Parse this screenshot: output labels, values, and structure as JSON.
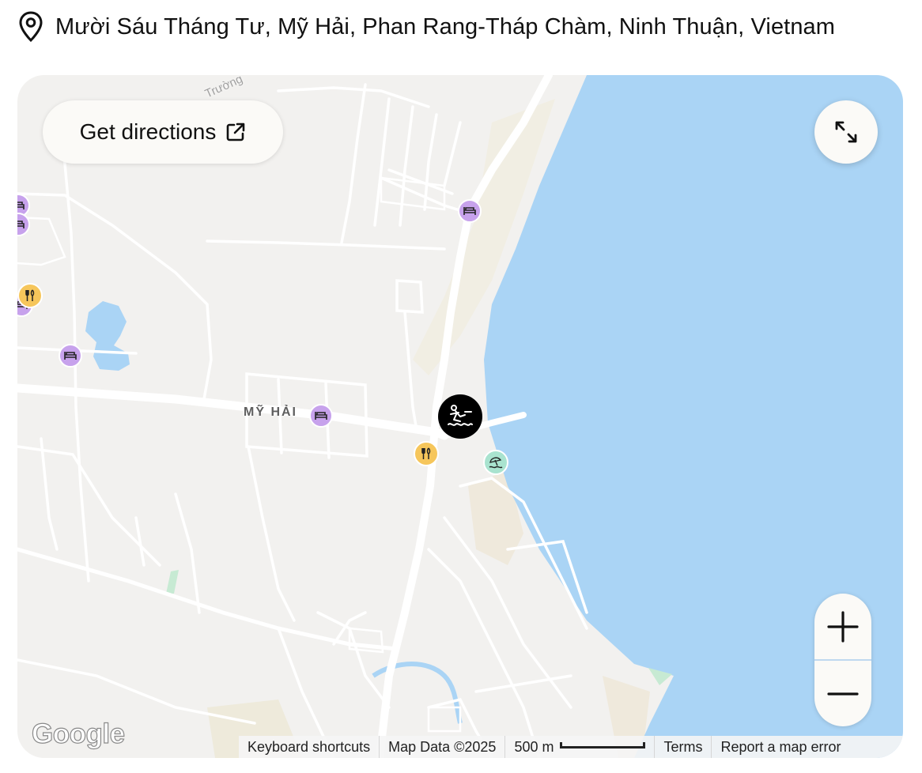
{
  "header": {
    "address": "Mười Sáu Tháng Tư, Mỹ Hải, Phan Rang-Tháp Chàm, Ninh Thuận, Vietnam",
    "icon": "map-pin-icon"
  },
  "map": {
    "directions_label": "Get directions",
    "directions_icon": "external-link-icon",
    "fullscreen_icon": "expand-icon",
    "zoom_in_icon": "plus-icon",
    "zoom_out_icon": "minus-icon",
    "area_label": "MỸ HẢI",
    "street_label": "Trường",
    "logo_text": "Google",
    "attribution": {
      "shortcuts": "Keyboard shortcuts",
      "map_data": "Map Data ©2025",
      "scale": "500 m",
      "terms": "Terms",
      "report": "Report a map error"
    },
    "colors": {
      "land": "#f2f1ef",
      "water": "#aad4f5",
      "hotel_marker": "#c7a2ec",
      "food_marker": "#f6c65b",
      "beach_marker": "#a9e3cf",
      "selected_marker": "#000000"
    },
    "markers": {
      "selected": "water-sports-icon",
      "hotel": "bed-icon",
      "food": "fork-knife-icon",
      "beach": "beach-umbrella-icon"
    }
  }
}
